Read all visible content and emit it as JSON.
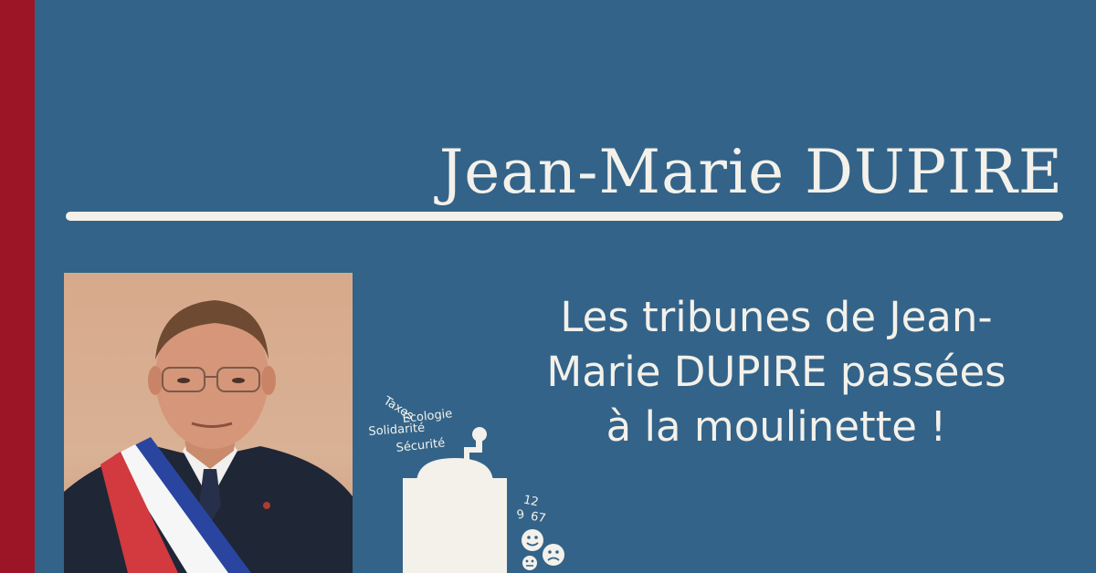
{
  "header": {
    "title": "Jean-Marie DUPIRE"
  },
  "tagline": {
    "text": "Les tribunes de Jean-Marie DUPIRE passées à la moulinette !"
  },
  "grinder": {
    "words": [
      "Taxes",
      "Écologie",
      "Solidarité",
      "Sécurité"
    ],
    "numbers": [
      "12",
      "9",
      "67"
    ]
  },
  "colors": {
    "background": "#336389",
    "accent_band": "#9b1526",
    "foreground": "#f3f1ea"
  }
}
